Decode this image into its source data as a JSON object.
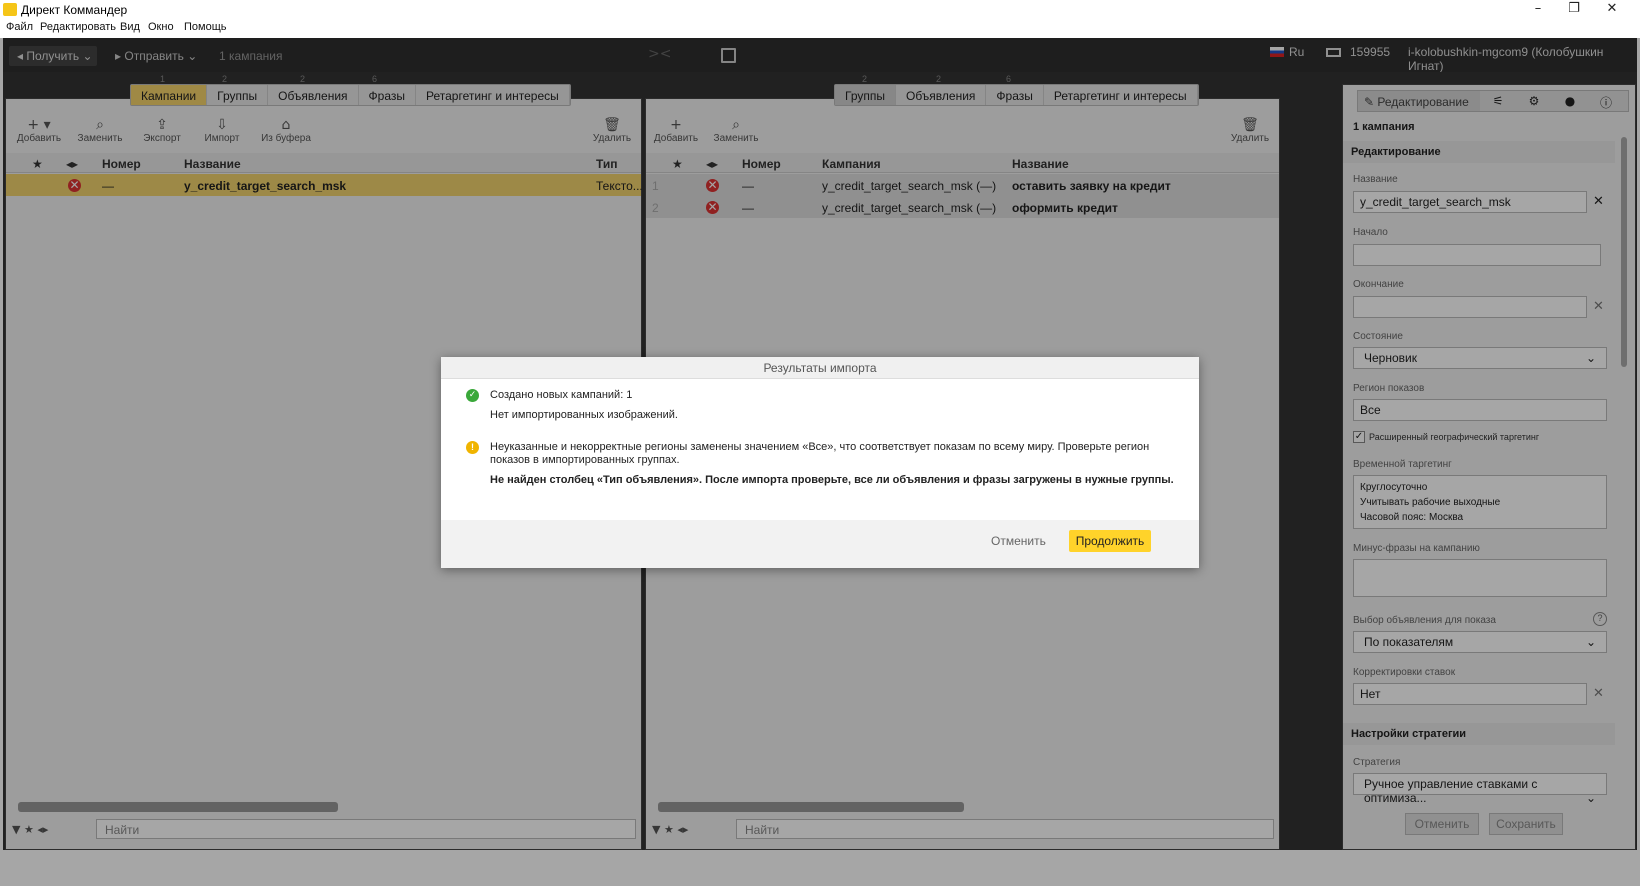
{
  "window": {
    "title": "Директ Коммандер",
    "minimize": "–",
    "restore": "❐",
    "close": "✕"
  },
  "menu": [
    "Файл",
    "Редактировать",
    "Вид",
    "Окно",
    "Помощь"
  ],
  "toolbar": {
    "get_label": "Получить",
    "send_label": "Отправить",
    "campaign_count": "1 кампания",
    "lang": "Ru",
    "balance": "159955",
    "account": "i-kolobushkin-mgcom9 (Колобушкин Игнат)"
  },
  "left_panel": {
    "tabs": [
      "Кампании",
      "Группы",
      "Объявления",
      "Фразы",
      "Ретаргетинг и интересы"
    ],
    "tab_counts": [
      "1",
      "2",
      "2",
      "6"
    ],
    "tools": [
      "Добавить",
      "Заменить",
      "Экспорт",
      "Импорт",
      "Из буфера"
    ],
    "delete_label": "Удалить",
    "columns": [
      "Номер",
      "Название",
      "Тип ка..."
    ],
    "rows": [
      {
        "number": "—",
        "name": "y_credit_target_search_msk",
        "type": "Тексто..."
      }
    ],
    "search_placeholder": "Найти"
  },
  "mid_panel": {
    "tabs": [
      "Группы",
      "Объявления",
      "Фразы",
      "Ретаргетинг и интересы"
    ],
    "tab_counts": [
      "2",
      "2",
      "6"
    ],
    "tools": [
      "Добавить",
      "Заменить"
    ],
    "delete_label": "Удалить",
    "columns": [
      "Номер",
      "Кампания",
      "Название"
    ],
    "rows": [
      {
        "idx": "1",
        "number": "—",
        "campaign": "y_credit_target_search_msk (—)",
        "name": "оставить заявку на кредит"
      },
      {
        "idx": "2",
        "number": "—",
        "campaign": "y_credit_target_search_msk (—)",
        "name": "оформить кредит"
      }
    ],
    "search_placeholder": "Найти"
  },
  "right_panel": {
    "edit_tab": "Редактирование",
    "header": "1 кампания",
    "section_edit": "Редактирование",
    "name_label": "Название",
    "name_value": "y_credit_target_search_msk",
    "start_label": "Начало",
    "end_label": "Окончание",
    "state_label": "Состояние",
    "state_value": "Черновик",
    "region_label": "Регион показов",
    "region_value": "Все",
    "geo_checkbox": "Расширенный географический таргетинг",
    "time_label": "Временной таргетинг",
    "time_lines": [
      "Круглосуточно",
      "Учитывать рабочие выходные",
      "Часовой пояс: Москва"
    ],
    "minus_label": "Минус-фразы на кампанию",
    "ad_select_label": "Выбор объявления для показа",
    "ad_select_value": "По показателям",
    "bid_adj_label": "Корректировки ставок",
    "bid_adj_value": "Нет",
    "section_strategy": "Настройки стратегии",
    "strategy_label": "Стратегия",
    "strategy_value": "Ручное управление ставками с оптимиза...",
    "cancel": "Отменить",
    "save": "Сохранить"
  },
  "modal": {
    "title": "Результаты импорта",
    "created": "Создано новых кампаний: 1",
    "no_images": "Нет импортированных изображений.",
    "warning_line1": "Неуказанные и некорректные регионы заменены значением «Все», что соответствует показам по всему миру. Проверьте регион",
    "warning_line2": "показов в импортированных группах.",
    "bold_warning": "Не найден столбец «Тип объявления». После импорта проверьте, все ли объявления и фразы загружены в нужные группы.",
    "cancel": "Отменить",
    "continue": "Продолжить"
  },
  "colors": {
    "accent": "#f5d36a",
    "primary_button": "#ffd32a",
    "error": "#dd3333",
    "success": "#3aa83a",
    "warning": "#f0b400"
  }
}
